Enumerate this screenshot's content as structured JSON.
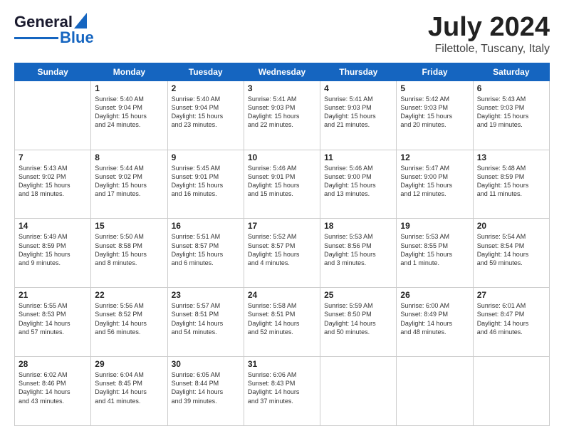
{
  "logo": {
    "line1": "General",
    "line2": "Blue"
  },
  "header": {
    "month": "July 2024",
    "location": "Filettole, Tuscany, Italy"
  },
  "days": [
    "Sunday",
    "Monday",
    "Tuesday",
    "Wednesday",
    "Thursday",
    "Friday",
    "Saturday"
  ],
  "weeks": [
    [
      {
        "day": "",
        "content": ""
      },
      {
        "day": "1",
        "content": "Sunrise: 5:40 AM\nSunset: 9:04 PM\nDaylight: 15 hours\nand 24 minutes."
      },
      {
        "day": "2",
        "content": "Sunrise: 5:40 AM\nSunset: 9:04 PM\nDaylight: 15 hours\nand 23 minutes."
      },
      {
        "day": "3",
        "content": "Sunrise: 5:41 AM\nSunset: 9:03 PM\nDaylight: 15 hours\nand 22 minutes."
      },
      {
        "day": "4",
        "content": "Sunrise: 5:41 AM\nSunset: 9:03 PM\nDaylight: 15 hours\nand 21 minutes."
      },
      {
        "day": "5",
        "content": "Sunrise: 5:42 AM\nSunset: 9:03 PM\nDaylight: 15 hours\nand 20 minutes."
      },
      {
        "day": "6",
        "content": "Sunrise: 5:43 AM\nSunset: 9:03 PM\nDaylight: 15 hours\nand 19 minutes."
      }
    ],
    [
      {
        "day": "7",
        "content": "Sunrise: 5:43 AM\nSunset: 9:02 PM\nDaylight: 15 hours\nand 18 minutes."
      },
      {
        "day": "8",
        "content": "Sunrise: 5:44 AM\nSunset: 9:02 PM\nDaylight: 15 hours\nand 17 minutes."
      },
      {
        "day": "9",
        "content": "Sunrise: 5:45 AM\nSunset: 9:01 PM\nDaylight: 15 hours\nand 16 minutes."
      },
      {
        "day": "10",
        "content": "Sunrise: 5:46 AM\nSunset: 9:01 PM\nDaylight: 15 hours\nand 15 minutes."
      },
      {
        "day": "11",
        "content": "Sunrise: 5:46 AM\nSunset: 9:00 PM\nDaylight: 15 hours\nand 13 minutes."
      },
      {
        "day": "12",
        "content": "Sunrise: 5:47 AM\nSunset: 9:00 PM\nDaylight: 15 hours\nand 12 minutes."
      },
      {
        "day": "13",
        "content": "Sunrise: 5:48 AM\nSunset: 8:59 PM\nDaylight: 15 hours\nand 11 minutes."
      }
    ],
    [
      {
        "day": "14",
        "content": "Sunrise: 5:49 AM\nSunset: 8:59 PM\nDaylight: 15 hours\nand 9 minutes."
      },
      {
        "day": "15",
        "content": "Sunrise: 5:50 AM\nSunset: 8:58 PM\nDaylight: 15 hours\nand 8 minutes."
      },
      {
        "day": "16",
        "content": "Sunrise: 5:51 AM\nSunset: 8:57 PM\nDaylight: 15 hours\nand 6 minutes."
      },
      {
        "day": "17",
        "content": "Sunrise: 5:52 AM\nSunset: 8:57 PM\nDaylight: 15 hours\nand 4 minutes."
      },
      {
        "day": "18",
        "content": "Sunrise: 5:53 AM\nSunset: 8:56 PM\nDaylight: 15 hours\nand 3 minutes."
      },
      {
        "day": "19",
        "content": "Sunrise: 5:53 AM\nSunset: 8:55 PM\nDaylight: 15 hours\nand 1 minute."
      },
      {
        "day": "20",
        "content": "Sunrise: 5:54 AM\nSunset: 8:54 PM\nDaylight: 14 hours\nand 59 minutes."
      }
    ],
    [
      {
        "day": "21",
        "content": "Sunrise: 5:55 AM\nSunset: 8:53 PM\nDaylight: 14 hours\nand 57 minutes."
      },
      {
        "day": "22",
        "content": "Sunrise: 5:56 AM\nSunset: 8:52 PM\nDaylight: 14 hours\nand 56 minutes."
      },
      {
        "day": "23",
        "content": "Sunrise: 5:57 AM\nSunset: 8:51 PM\nDaylight: 14 hours\nand 54 minutes."
      },
      {
        "day": "24",
        "content": "Sunrise: 5:58 AM\nSunset: 8:51 PM\nDaylight: 14 hours\nand 52 minutes."
      },
      {
        "day": "25",
        "content": "Sunrise: 5:59 AM\nSunset: 8:50 PM\nDaylight: 14 hours\nand 50 minutes."
      },
      {
        "day": "26",
        "content": "Sunrise: 6:00 AM\nSunset: 8:49 PM\nDaylight: 14 hours\nand 48 minutes."
      },
      {
        "day": "27",
        "content": "Sunrise: 6:01 AM\nSunset: 8:47 PM\nDaylight: 14 hours\nand 46 minutes."
      }
    ],
    [
      {
        "day": "28",
        "content": "Sunrise: 6:02 AM\nSunset: 8:46 PM\nDaylight: 14 hours\nand 43 minutes."
      },
      {
        "day": "29",
        "content": "Sunrise: 6:04 AM\nSunset: 8:45 PM\nDaylight: 14 hours\nand 41 minutes."
      },
      {
        "day": "30",
        "content": "Sunrise: 6:05 AM\nSunset: 8:44 PM\nDaylight: 14 hours\nand 39 minutes."
      },
      {
        "day": "31",
        "content": "Sunrise: 6:06 AM\nSunset: 8:43 PM\nDaylight: 14 hours\nand 37 minutes."
      },
      {
        "day": "",
        "content": ""
      },
      {
        "day": "",
        "content": ""
      },
      {
        "day": "",
        "content": ""
      }
    ]
  ]
}
